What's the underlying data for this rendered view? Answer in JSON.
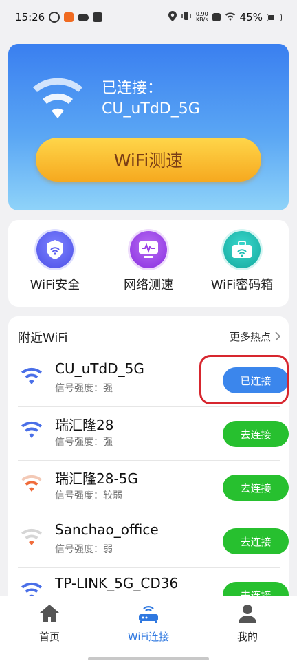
{
  "status_bar": {
    "time": "15:26",
    "net_speed_value": "0.90",
    "net_speed_unit": "KB/s",
    "battery": "45%"
  },
  "hero": {
    "connected_label": "已连接：",
    "ssid": "CU_uTdD_5G",
    "speed_test_button": "WiFi测速"
  },
  "tools": [
    {
      "label": "WiFi安全",
      "icon": "shield-icon",
      "color": "#5b5ef0"
    },
    {
      "label": "网络测速",
      "icon": "monitor-pulse-icon",
      "color": "#9a3ee6"
    },
    {
      "label": "WiFi密码箱",
      "icon": "briefcase-icon",
      "color": "#1fbfb4"
    }
  ],
  "nearby": {
    "title": "附近WiFi",
    "more_label": "更多热点",
    "networks": [
      {
        "name": "CU_uTdD_5G",
        "signal": "信号强度：强",
        "action": "已连接",
        "state": "connected",
        "wifi_color": "#4a6fe8"
      },
      {
        "name": "瑞汇隆28",
        "signal": "信号强度：强",
        "action": "去连接",
        "state": "connect",
        "wifi_color": "#4a6fe8"
      },
      {
        "name": "瑞汇隆28-5G",
        "signal": "信号强度：较弱",
        "action": "去连接",
        "state": "connect",
        "wifi_color": "#f06b3a"
      },
      {
        "name": "Sanchao_office",
        "signal": "信号强度：弱",
        "action": "去连接",
        "state": "connect",
        "wifi_color": "#c8c8c8"
      },
      {
        "name": "TP-LINK_5G_CD36",
        "signal": "",
        "action": "去连接",
        "state": "connect",
        "wifi_color": "#4a6fe8"
      }
    ]
  },
  "nav": {
    "home": "首页",
    "wifi": "WiFi连接",
    "me": "我的",
    "active_color": "#2f78e0"
  }
}
